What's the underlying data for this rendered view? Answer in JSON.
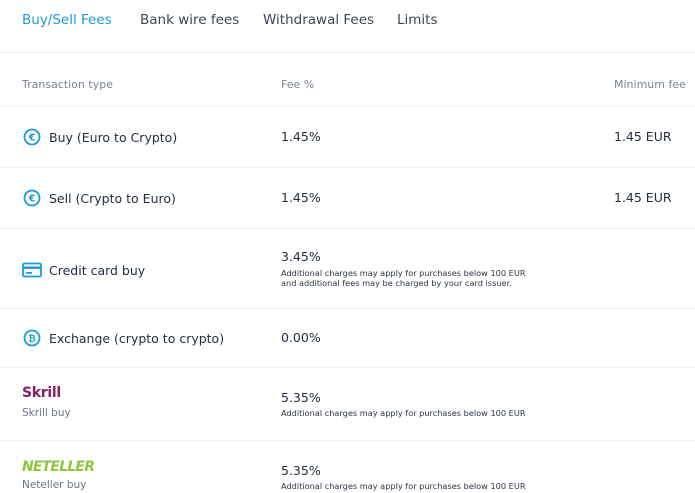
{
  "tabs": [
    {
      "label": "Buy/Sell Fees",
      "active": true
    },
    {
      "label": "Bank wire fees",
      "active": false
    },
    {
      "label": "Withdrawal Fees",
      "active": false
    },
    {
      "label": "Limits",
      "active": false
    }
  ],
  "table": {
    "headers": {
      "type": "Transaction type",
      "fee": "Fee %",
      "min": "Minimum fee"
    },
    "rows": [
      {
        "label": "Buy (Euro to Crypto)",
        "icon": "euro-coin-icon",
        "fee": "1.45%",
        "min": "1.45 EUR"
      },
      {
        "label": "Sell (Crypto to Euro)",
        "icon": "euro-coin-icon",
        "fee": "1.45%",
        "min": "1.45 EUR"
      },
      {
        "label": "Credit card buy",
        "icon": "credit-card-icon",
        "fee": "3.45%",
        "note1": "Additional charges may apply for purchases below 100 EUR",
        "note2": "and additional fees may be charged by your card issuer."
      },
      {
        "label": "Exchange (crypto to crypto)",
        "icon": "bitcoin-coin-icon",
        "fee": "0.00%"
      },
      {
        "logo": "Skrill",
        "label": "Skrill buy",
        "fee": "5.35%",
        "note1": "Additional charges may apply for purchases below 100 EUR"
      },
      {
        "logo": "NETELLER",
        "label": "Neteller buy",
        "fee": "5.35%",
        "note1": "Additional charges may apply for purchases below 100 EUR"
      }
    ]
  },
  "colors": {
    "accent": "#1a9bd7",
    "skrill": "#862165",
    "neteller": "#8dc63f"
  }
}
